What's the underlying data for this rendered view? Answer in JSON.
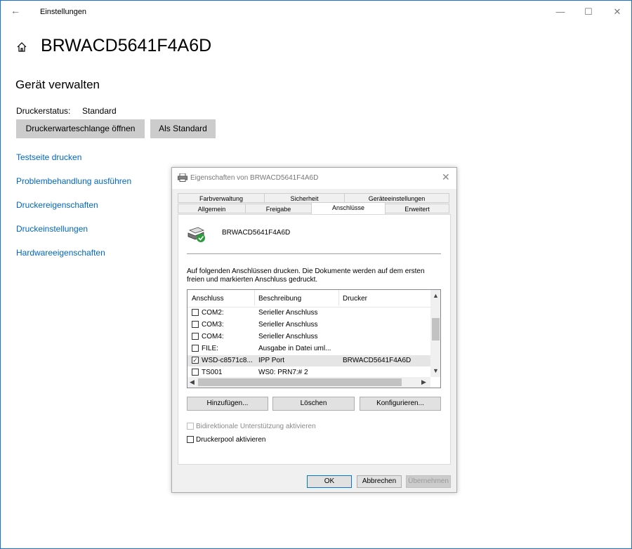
{
  "window": {
    "title": "Einstellungen",
    "back_icon": "arrow-left-icon",
    "controls": {
      "minimize": "—",
      "maximize": "☐",
      "close": "✕"
    }
  },
  "header": {
    "home_icon": "home-icon",
    "title": "BRWACD5641F4A6D"
  },
  "manage": {
    "section_title": "Gerät verwalten",
    "status_label": "Druckerstatus:",
    "status_value": "Standard",
    "queue_button": "Druckerwarteschlange öffnen",
    "default_button": "Als Standard"
  },
  "links": [
    "Testseite drucken",
    "Problembehandlung ausführen",
    "Druckereigenschaften",
    "Druckeinstellungen",
    "Hardwareeigenschaften"
  ],
  "dialog": {
    "title": "Eigenschaften von BRWACD5641F4A6D",
    "tabs_row1": [
      "Farbverwaltung",
      "Sicherheit",
      "Geräteeinstellungen"
    ],
    "tabs_row2": [
      "Allgemein",
      "Freigabe",
      "Anschlüsse",
      "Erweitert"
    ],
    "active_tab": "Anschlüsse",
    "printer_name": "BRWACD5641F4A6D",
    "description": "Auf folgenden Anschlüssen drucken. Die Dokumente werden auf dem ersten freien und markierten Anschluss gedruckt.",
    "columns": [
      "Anschluss",
      "Beschreibung",
      "Drucker"
    ],
    "ports": [
      {
        "port": "COM2:",
        "description": "Serieller Anschluss",
        "printer": "",
        "checked": false,
        "selected": false
      },
      {
        "port": "COM3:",
        "description": "Serieller Anschluss",
        "printer": "",
        "checked": false,
        "selected": false
      },
      {
        "port": "COM4:",
        "description": "Serieller Anschluss",
        "printer": "",
        "checked": false,
        "selected": false
      },
      {
        "port": "FILE:",
        "description": "Ausgabe in Datei uml...",
        "printer": "",
        "checked": false,
        "selected": false
      },
      {
        "port": "WSD-c8571c8...",
        "description": "IPP Port",
        "printer": "BRWACD5641F4A6D",
        "checked": true,
        "selected": true
      },
      {
        "port": "TS001",
        "description": "WS0:  PRN7:# 2",
        "printer": "",
        "checked": false,
        "selected": false
      }
    ],
    "port_buttons": {
      "add": "Hinzufügen...",
      "delete": "Löschen",
      "configure": "Konfigurieren..."
    },
    "bidi_label": "Bidirektionale Unterstützung aktivieren",
    "pool_label": "Druckerpool aktivieren",
    "ok": "OK",
    "cancel": "Abbrechen",
    "apply": "Übernehmen"
  },
  "colors": {
    "link": "#0067c0",
    "window_border": "#1a73c8",
    "gray_button": "#cccccc"
  }
}
